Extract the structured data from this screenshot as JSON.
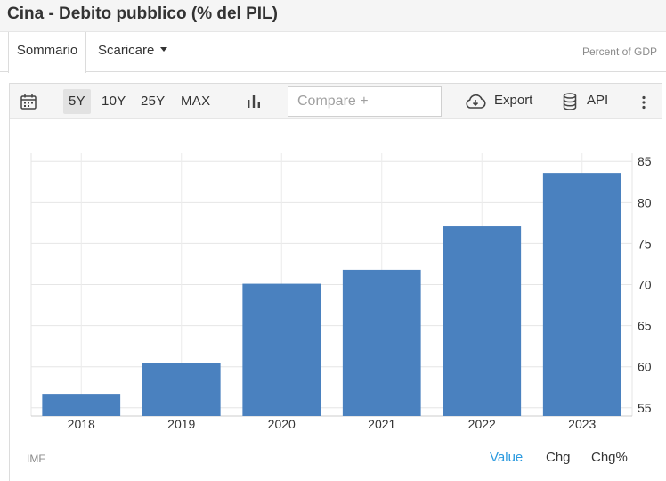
{
  "header": {
    "title": "Cina - Debito pubblico (% del PIL)"
  },
  "tabs": [
    {
      "label": "Sommario"
    },
    {
      "label": "Scaricare"
    }
  ],
  "toolbar": {
    "ranges": [
      "5Y",
      "10Y",
      "25Y",
      "MAX"
    ],
    "active_range": "5Y",
    "compare_placeholder": "Compare +",
    "export_label": "Export",
    "api_label": "API"
  },
  "chart_data": {
    "type": "bar",
    "categories": [
      "2018",
      "2019",
      "2020",
      "2021",
      "2022",
      "2023"
    ],
    "values": [
      56.7,
      60.4,
      70.1,
      71.8,
      77.1,
      83.6
    ],
    "unit_label": "Percent of GDP",
    "ylim": [
      54,
      86
    ],
    "yticks": [
      55,
      60,
      65,
      70,
      75,
      80,
      85
    ],
    "grid": true,
    "bar_color": "#4a81bf",
    "y_axis_side": "right"
  },
  "footer": {
    "source": "IMF",
    "views": [
      "Value",
      "Chg",
      "Chg%"
    ],
    "active_view": "Value",
    "accent_color": "#2b9adf"
  }
}
